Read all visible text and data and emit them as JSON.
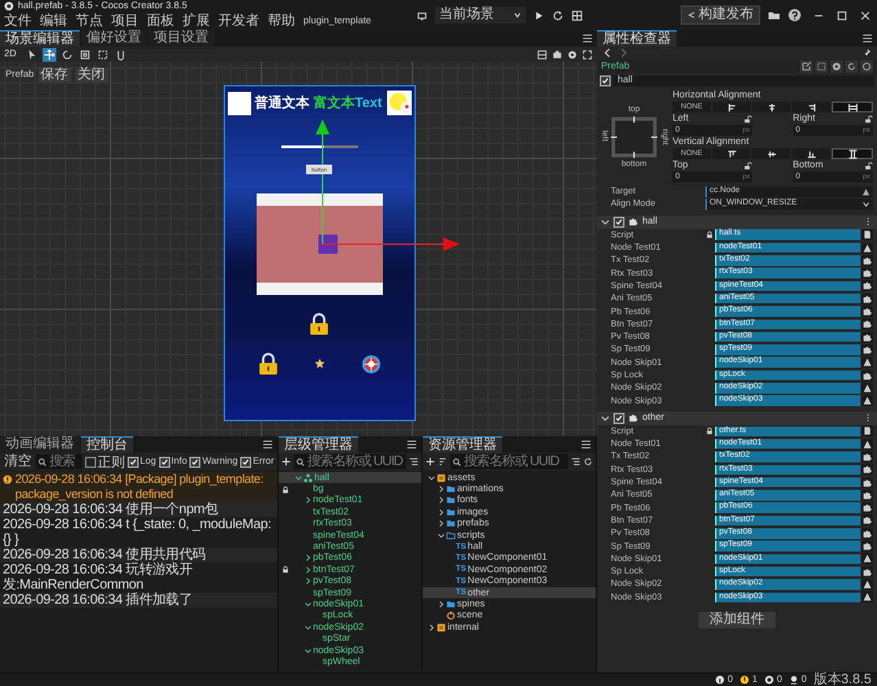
{
  "window": {
    "title": "hall.prefab - 3.8.5 - Cocos Creator 3.8.5",
    "menu": [
      "文件",
      "编辑",
      "节点",
      "项目",
      "面板",
      "扩展",
      "开发者",
      "帮助",
      "plugin_template"
    ],
    "scene_select": "当前场景",
    "build_button": "构建发布"
  },
  "scene_editor": {
    "tabs": [
      {
        "label": "场景编辑器",
        "selected": true
      },
      {
        "label": "偏好设置",
        "selected": false
      },
      {
        "label": "项目设置",
        "selected": false
      }
    ],
    "mode": "2D",
    "tools": [
      {
        "kind": "select",
        "selected": false
      },
      {
        "kind": "move",
        "selected": true
      },
      {
        "kind": "rotate",
        "selected": false
      },
      {
        "kind": "scale",
        "selected": false
      },
      {
        "kind": "rect",
        "selected": false
      },
      {
        "kind": "transform",
        "selected": false
      }
    ],
    "prefab_bar": {
      "label": "Prefab",
      "save": "保存",
      "close": "关闭"
    },
    "game": {
      "label": "普通文本",
      "rich_text": [
        {
          "text": "富文本",
          "color": "#2ecc40"
        },
        {
          "text": "Text",
          "color": "#2ec4d0"
        }
      ],
      "progress": {
        "level": 0.56
      },
      "button": "button"
    }
  },
  "console": {
    "tabs": [
      {
        "label": "动画编辑器",
        "selected": false
      },
      {
        "label": "控制台",
        "selected": true
      }
    ],
    "clear": "清空",
    "search": {
      "placeholder": "搜索"
    },
    "filters": [
      {
        "label": "正则",
        "checked": false
      },
      {
        "label": "Log",
        "checked": true
      },
      {
        "label": "Info",
        "checked": true
      },
      {
        "label": "Warning",
        "checked": true
      },
      {
        "label": "Error",
        "checked": true
      }
    ],
    "lines": [
      {
        "kind": "warning",
        "text": "2026-09-28 16:06:34 [Package] plugin_template: package_version is not defined"
      },
      {
        "kind": "log",
        "text": "2026-09-28 16:06:34 使用一个npm包"
      },
      {
        "kind": "log",
        "text": "2026-09-28 16:06:34 t {_state: 0, _moduleMap: {} }"
      },
      {
        "kind": "log",
        "text": "2026-09-28 16:06:34 使用共用代码"
      },
      {
        "kind": "log",
        "text": "2026-09-28 16:06:34 玩转游戏开发:MainRenderCommon"
      },
      {
        "kind": "log",
        "text": "2026-09-28 16:06:34 插件加载了"
      }
    ]
  },
  "hierarchy": {
    "title": "层级管理器",
    "search": {
      "placeholder": "搜索名称或 UUID"
    },
    "tree": [
      {
        "name": "hall",
        "expanded": true,
        "selected": true,
        "locked": false,
        "children": [
          {
            "name": "bg",
            "selected": false,
            "locked": true
          },
          {
            "name": "nodeTest01",
            "expanded": false,
            "selected": false,
            "locked": false
          },
          {
            "name": "txTest02",
            "selected": false,
            "locked": false
          },
          {
            "name": "rtxTest03",
            "selected": false,
            "locked": false
          },
          {
            "name": "spineTest04",
            "selected": false,
            "locked": false
          },
          {
            "name": "aniTest05",
            "selected": false,
            "locked": false
          },
          {
            "name": "pbTest06",
            "expanded": false,
            "selected": false,
            "locked": false
          },
          {
            "name": "btnTest07",
            "expanded": false,
            "selected": false,
            "locked": true
          },
          {
            "name": "pvTest08",
            "expanded": false,
            "selected": false,
            "locked": false
          },
          {
            "name": "spTest09",
            "selected": false,
            "locked": false
          },
          {
            "name": "nodeSkip01",
            "expanded": true,
            "selected": false,
            "locked": false,
            "children": [
              {
                "name": "spLock",
                "selected": false,
                "locked": false
              }
            ]
          },
          {
            "name": "nodeSkip02",
            "expanded": true,
            "selected": false,
            "locked": false,
            "children": [
              {
                "name": "spStar",
                "selected": false,
                "locked": false
              }
            ]
          },
          {
            "name": "nodeSkip03",
            "expanded": true,
            "selected": false,
            "locked": false,
            "children": [
              {
                "name": "spWheel",
                "selected": false,
                "locked": false
              }
            ]
          }
        ]
      }
    ]
  },
  "assets": {
    "title": "资源管理器",
    "search": {
      "placeholder": "搜索名称或 UUID"
    },
    "tree": [
      {
        "name": "assets",
        "kind": "database",
        "expanded": true,
        "selected": false,
        "children": [
          {
            "name": "animations",
            "kind": "folder",
            "expanded": false,
            "selected": false
          },
          {
            "name": "fonts",
            "kind": "folder",
            "expanded": false,
            "selected": false
          },
          {
            "name": "images",
            "kind": "folder",
            "expanded": false,
            "selected": false
          },
          {
            "name": "prefabs",
            "kind": "folder",
            "expanded": false,
            "selected": false
          },
          {
            "name": "scripts",
            "kind": "folder",
            "expanded": true,
            "selected": false,
            "children": [
              {
                "name": "hall",
                "kind": "script",
                "badge": "TS",
                "selected": false
              },
              {
                "name": "NewComponent01",
                "kind": "script",
                "badge": "TS",
                "selected": false
              },
              {
                "name": "NewComponent02",
                "kind": "script",
                "badge": "TS",
                "selected": false
              },
              {
                "name": "NewComponent03",
                "kind": "script",
                "badge": "TS",
                "selected": false
              },
              {
                "name": "other",
                "kind": "script",
                "badge": "TS",
                "selected": true
              }
            ]
          },
          {
            "name": "spines",
            "kind": "folder",
            "expanded": false,
            "selected": false
          },
          {
            "name": "scene",
            "kind": "scene",
            "selected": false
          }
        ]
      },
      {
        "name": "internal",
        "kind": "database",
        "expanded": false,
        "selected": false
      }
    ]
  },
  "inspector": {
    "title": "属性检查器",
    "prefab": "Prefab",
    "node": {
      "name": "hall",
      "enabled": true
    },
    "widget": {
      "anchor_labels": {
        "top": "top",
        "left": "left",
        "right": "right",
        "bottom": "bottom"
      },
      "horizontal": {
        "label": "Horizontal Alignment",
        "options": [
          {
            "kind": "none",
            "label": "NONE",
            "selected": false
          },
          {
            "kind": "left",
            "selected": false
          },
          {
            "kind": "center",
            "selected": false
          },
          {
            "kind": "right",
            "selected": false
          },
          {
            "kind": "stretch",
            "selected": true
          }
        ]
      },
      "left": {
        "label": "Left",
        "value": "0",
        "unit": "px"
      },
      "right": {
        "label": "Right",
        "value": "0",
        "unit": "px"
      },
      "vertical": {
        "label": "Vertical Alignment",
        "options": [
          {
            "kind": "none",
            "label": "NONE",
            "selected": false
          },
          {
            "kind": "top",
            "selected": false
          },
          {
            "kind": "center",
            "selected": false
          },
          {
            "kind": "bottom",
            "selected": false
          },
          {
            "kind": "stretch",
            "selected": true
          }
        ]
      },
      "top": {
        "label": "Top",
        "value": "0",
        "unit": "px"
      },
      "bottom": {
        "label": "Bottom",
        "value": "0",
        "unit": "px"
      },
      "target": {
        "label": "Target",
        "value": "cc.Node"
      },
      "align_mode": {
        "label": "Align Mode",
        "value": "ON_WINDOW_RESIZE"
      }
    },
    "components": [
      {
        "name": "hall",
        "enabled": true,
        "rows": [
          {
            "label": "Script",
            "value": "hall.ts",
            "kind": "script"
          },
          {
            "label": "Node Test01",
            "value": "nodeTest01",
            "kind": "node"
          },
          {
            "label": "Tx Test02",
            "value": "txTest02",
            "kind": "component"
          },
          {
            "label": "Rtx Test03",
            "value": "rtxTest03",
            "kind": "component"
          },
          {
            "label": "Spine Test04",
            "value": "spineTest04",
            "kind": "component"
          },
          {
            "label": "Ani Test05",
            "value": "aniTest05",
            "kind": "component"
          },
          {
            "label": "Pb Test06",
            "value": "pbTest06",
            "kind": "component"
          },
          {
            "label": "Btn Test07",
            "value": "btnTest07",
            "kind": "component"
          },
          {
            "label": "Pv Test08",
            "value": "pvTest08",
            "kind": "component"
          },
          {
            "label": "Sp Test09",
            "value": "spTest09",
            "kind": "component"
          },
          {
            "label": "Node Skip01",
            "value": "nodeSkip01",
            "kind": "node"
          },
          {
            "label": "Sp Lock",
            "value": "spLock",
            "kind": "component"
          },
          {
            "label": "Node Skip02",
            "value": "nodeSkip02",
            "kind": "node"
          },
          {
            "label": "Node Skip03",
            "value": "nodeSkip03",
            "kind": "node"
          }
        ]
      },
      {
        "name": "other",
        "enabled": true,
        "rows": [
          {
            "label": "Script",
            "value": "other.ts",
            "kind": "script"
          },
          {
            "label": "Node Test01",
            "value": "nodeTest01",
            "kind": "node"
          },
          {
            "label": "Tx Test02",
            "value": "txTest02",
            "kind": "component"
          },
          {
            "label": "Rtx Test03",
            "value": "rtxTest03",
            "kind": "component"
          },
          {
            "label": "Spine Test04",
            "value": "spineTest04",
            "kind": "component"
          },
          {
            "label": "Ani Test05",
            "value": "aniTest05",
            "kind": "component"
          },
          {
            "label": "Pb Test06",
            "value": "pbTest06",
            "kind": "component"
          },
          {
            "label": "Btn Test07",
            "value": "btnTest07",
            "kind": "component"
          },
          {
            "label": "Pv Test08",
            "value": "pvTest08",
            "kind": "component"
          },
          {
            "label": "Sp Test09",
            "value": "spTest09",
            "kind": "component"
          },
          {
            "label": "Node Skip01",
            "value": "nodeSkip01",
            "kind": "node"
          },
          {
            "label": "Sp Lock",
            "value": "spLock",
            "kind": "component"
          },
          {
            "label": "Node Skip02",
            "value": "nodeSkip02",
            "kind": "node"
          },
          {
            "label": "Node Skip03",
            "value": "nodeSkip03",
            "kind": "node"
          }
        ]
      }
    ],
    "add_button": "添加组件"
  },
  "status_bar": {
    "counters": [
      {
        "kind": "info",
        "count": "0"
      },
      {
        "kind": "warning",
        "count": "1"
      },
      {
        "kind": "error",
        "count": "0"
      },
      {
        "kind": "sync",
        "count": "0"
      }
    ],
    "version": "版本3.8.5"
  }
}
